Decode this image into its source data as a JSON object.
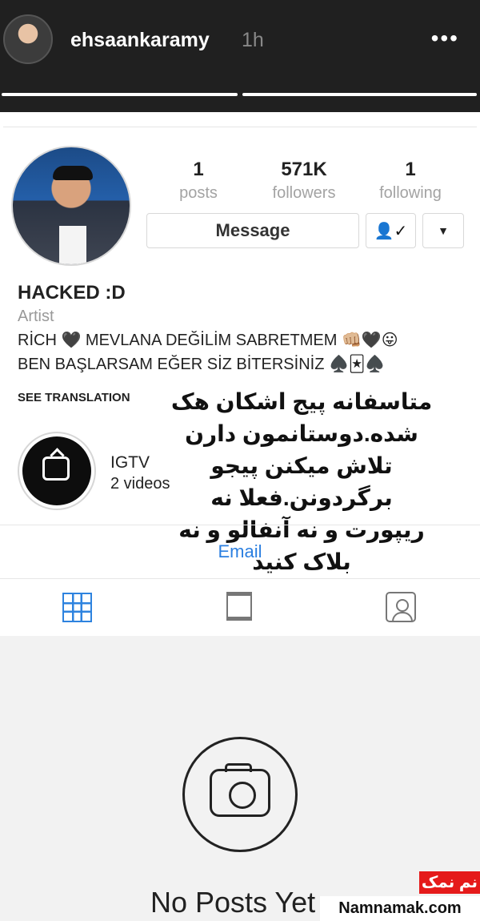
{
  "story": {
    "username": "ehsaankaramy",
    "time": "1h",
    "more": "•••"
  },
  "profile": {
    "stats": {
      "posts": {
        "value": "1",
        "label": "posts"
      },
      "followers": {
        "value": "571K",
        "label": "followers"
      },
      "following": {
        "value": "1",
        "label": "following"
      }
    },
    "message_label": "Message",
    "following_icon": "👤✓",
    "dropdown_icon": "▼",
    "name": "HACKED :D",
    "category": "Artist",
    "bio_line_1": "RİCH 🖤 MEVLANA DEĞİLİM SABRETMEM 👊🏼🖤😛",
    "bio_line_2": "BEN BAŞLARSAM EĞER SİZ BİTERSİNİZ ♠️🃏♠️",
    "see_translation": "SEE TRANSLATION",
    "persian_note": "متاسفانه پیج اشکان هک شده.دوستانمون دارن تلاش میکنن پیجو برگردونن.فعلا نه ریپورت و نه آنفالو و نه بلاک کنید",
    "igtv": {
      "label": "IGTV",
      "count": "2 videos"
    },
    "email": "Email",
    "no_posts": "No Posts Yet"
  },
  "watermark": {
    "red_text": "نم نمک",
    "site": "Namnamak.com"
  }
}
